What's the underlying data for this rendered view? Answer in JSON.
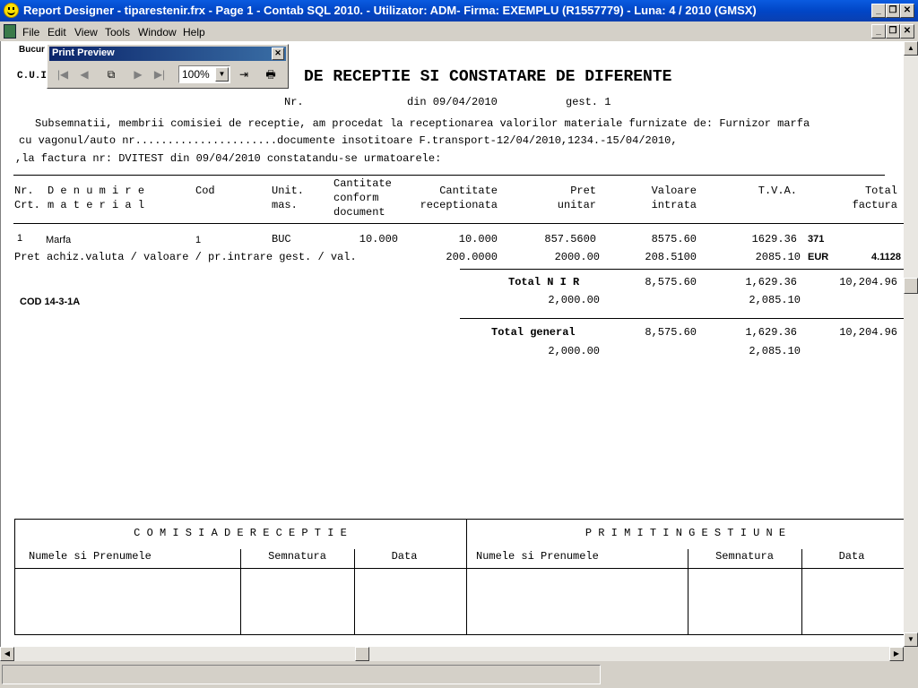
{
  "window": {
    "title": "Report Designer - tiparestenir.frx - Page 1 - Contab SQL 2010. - Utilizator: ADM- Firma: EXEMPLU (R1557779) - Luna: 4 / 2010      (GMSX)"
  },
  "menu": [
    "File",
    "Edit",
    "View",
    "Tools",
    "Window",
    "Help"
  ],
  "preview_toolbar": {
    "title": "Print Preview",
    "zoom": "100%"
  },
  "report": {
    "company_line": "Bucur",
    "cui_label": "C.U.I.",
    "title": "DE RECEPTIE SI CONSTATARE DE DIFERENTE",
    "nr_label": "Nr.",
    "date_line": "din 09/04/2010",
    "gest_line": "gest. 1",
    "para1": "Subsemnatii, membrii comisiei de receptie, am procedat la receptionarea valorilor materiale furnizate de: Furnizor marfa",
    "para2": "cu vagonul/auto nr......................documente insotitoare F.transport-12/04/2010,1234.-15/04/2010,",
    "para3": ",la factura nr: DVITEST     din 09/04/2010   constatandu-se urmatoarele:",
    "headers": {
      "nr": "Nr.",
      "crt": "Crt.",
      "den1": "D e n u m i r e",
      "den2": "m a t e r i a l",
      "cod": "Cod",
      "um1": "Unit.",
      "um2": "mas.",
      "cc1": "Cantitate",
      "cc2": "conform",
      "cc3": "document",
      "cr1": "Cantitate",
      "cr2": "receptionata",
      "pu1": "Pret",
      "pu2": "unitar",
      "vi1": "Valoare",
      "vi2": "intrata",
      "tva": "T.V.A.",
      "tf1": "Total",
      "tf2": "factura"
    },
    "row": {
      "nr": "1",
      "name": "Marfa",
      "cod": "1",
      "um": "BUC",
      "qty_doc": "10.000",
      "qty_rec": "10.000",
      "price": "857.5600",
      "value": "8575.60",
      "tva": "1629.36",
      "account": "371"
    },
    "row2": {
      "label": "Pret achiz.valuta / valoare / pr.intrare gest. / val.",
      "v1": "200.0000",
      "v2": "2000.00",
      "v3": "208.5100",
      "v4": "2085.10",
      "currency": "EUR",
      "rate": "4.1128"
    },
    "total_nir": {
      "label": "Total  N I R",
      "value": "8,575.60",
      "tva": "1,629.36",
      "total": "10,204.96",
      "sub1": "2,000.00",
      "sub2": "2,085.10"
    },
    "cod_label": "COD 14-3-1A",
    "total_general": {
      "label": "Total  general",
      "value": "8,575.60",
      "tva": "1,629.36",
      "total": "10,204.96",
      "sub1": "2,000.00",
      "sub2": "2,085.10"
    },
    "footer": {
      "left_title": "C O M I S I A   D E   R E C E P T I E",
      "right_title": "P R I M I T   I N   G E S T I U N E",
      "name_col": "Numele si Prenumele",
      "sign_col": "Semnatura",
      "date_col": "Data"
    }
  }
}
